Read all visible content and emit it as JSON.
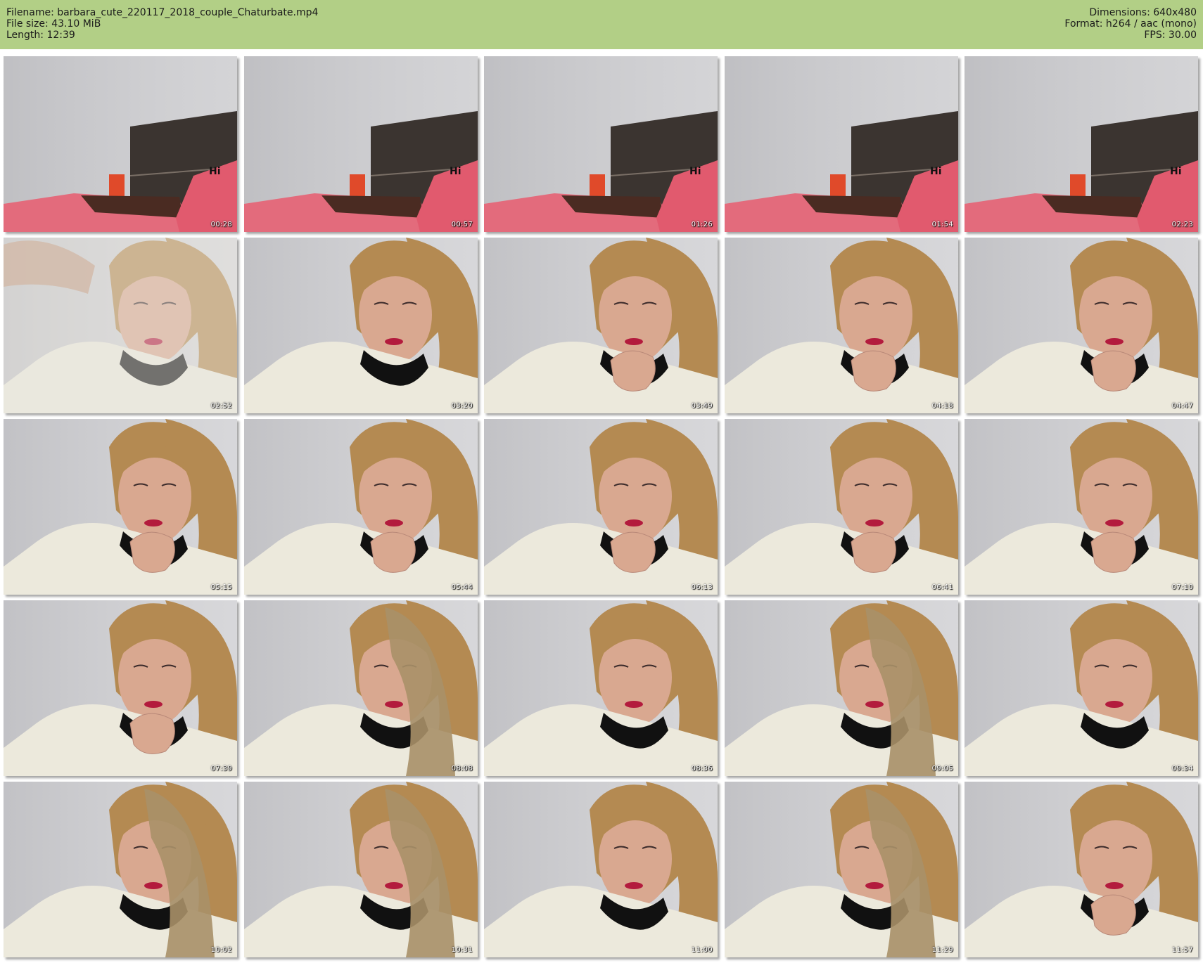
{
  "header": {
    "filename_line": "Filename: barbara_cute_220117_2018_couple_Chaturbate.mp4",
    "filesize_line": "File size: 43.10 MiB",
    "length_line": "Length: 12:39",
    "dimensions_line": "Dimensions: 640x480",
    "format_line": "Format: h264 / aac (mono)",
    "fps_line": "FPS: 30.00"
  },
  "colors": {
    "header_bg": "#b2cf86",
    "wall": "#c9c9cc",
    "headboard": "#3b3430",
    "bedspread": "#e36b7c",
    "hair": "#b48a52",
    "skin": "#d9a890",
    "lips": "#b31b3d",
    "collar": "#111111",
    "blouse": "#ece9dc"
  },
  "thumbnails": [
    {
      "time": "00:28",
      "scene": "room"
    },
    {
      "time": "00:57",
      "scene": "room"
    },
    {
      "time": "01:26",
      "scene": "room"
    },
    {
      "time": "01:54",
      "scene": "room"
    },
    {
      "time": "02:23",
      "scene": "room"
    },
    {
      "time": "02:52",
      "scene": "person-blur"
    },
    {
      "time": "03:20",
      "scene": "person"
    },
    {
      "time": "03:49",
      "scene": "person-hand"
    },
    {
      "time": "04:18",
      "scene": "person-hand"
    },
    {
      "time": "04:47",
      "scene": "person-hand"
    },
    {
      "time": "05:15",
      "scene": "person-hand"
    },
    {
      "time": "05:44",
      "scene": "person-hand"
    },
    {
      "time": "06:13",
      "scene": "person-hand"
    },
    {
      "time": "06:41",
      "scene": "person-hand"
    },
    {
      "time": "07:10",
      "scene": "person-hand"
    },
    {
      "time": "07:39",
      "scene": "person-hand"
    },
    {
      "time": "08:08",
      "scene": "person-hair"
    },
    {
      "time": "08:36",
      "scene": "person"
    },
    {
      "time": "09:05",
      "scene": "person-hair"
    },
    {
      "time": "09:34",
      "scene": "person"
    },
    {
      "time": "10:02",
      "scene": "person-hair"
    },
    {
      "time": "10:31",
      "scene": "person-hair"
    },
    {
      "time": "11:00",
      "scene": "person"
    },
    {
      "time": "11:29",
      "scene": "person-hair"
    },
    {
      "time": "11:57",
      "scene": "person-hand"
    }
  ]
}
